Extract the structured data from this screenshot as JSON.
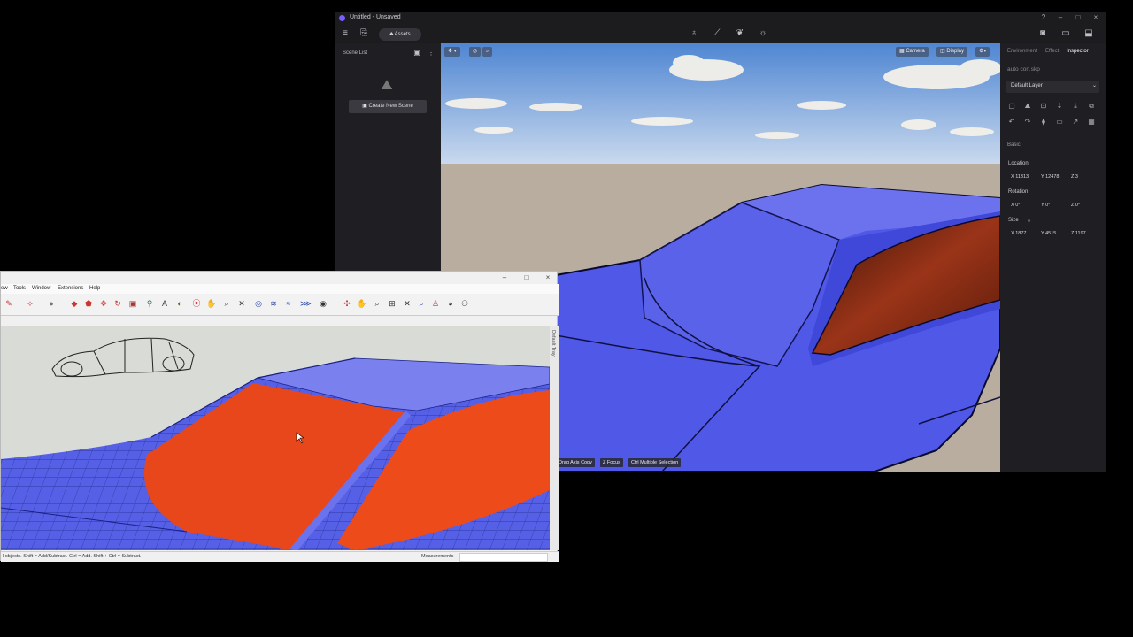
{
  "d5": {
    "title": "Untitled - Unsaved",
    "toolbar": {
      "assets_label": "Assets"
    },
    "sidebar": {
      "scene_list_label": "Scene List",
      "create_scene_label": "Create New Scene"
    },
    "viewport": {
      "camera_label": "Camera",
      "display_label": "Display",
      "hints": [
        {
          "key": "",
          "label": "Drag Axis Copy"
        },
        {
          "key": "Z",
          "label": "Focus"
        },
        {
          "key": "Ctrl",
          "label": "Multiple Selection"
        }
      ]
    },
    "inspector": {
      "tabs": [
        "Environment",
        "Effect",
        "Inspector"
      ],
      "active_tab": "Inspector",
      "file_name": "auto con.skp",
      "layer": "Default Layer",
      "section": "Basic",
      "location_label": "Location",
      "location": {
        "x": "X  11313",
        "y": "Y  12478",
        "z": "Z  3"
      },
      "rotation_label": "Rotation",
      "rotation": {
        "x": "X  0°",
        "y": "Y  0°",
        "z": "Z  0°"
      },
      "size_label": "Size",
      "size": {
        "x": "X  1877",
        "y": "Y  4515",
        "z": "Z  1197"
      }
    }
  },
  "sketchup": {
    "menus": [
      "ew",
      "Tools",
      "Window",
      "Extensions",
      "Help"
    ],
    "tray_label": "Default Tray",
    "status_text": "l objects. Shift = Add/Subtract. Ctrl = Add. Shift + Ctrl = Subtract.",
    "measurements_label": "Measurements"
  },
  "colors": {
    "car_blue": "#4b55e6",
    "car_blue_light": "#7178f0",
    "car_red": "#e8431a",
    "sky_top": "#5a8fd6",
    "ground": "#b7ac9f",
    "accent": "#7a5cff"
  }
}
